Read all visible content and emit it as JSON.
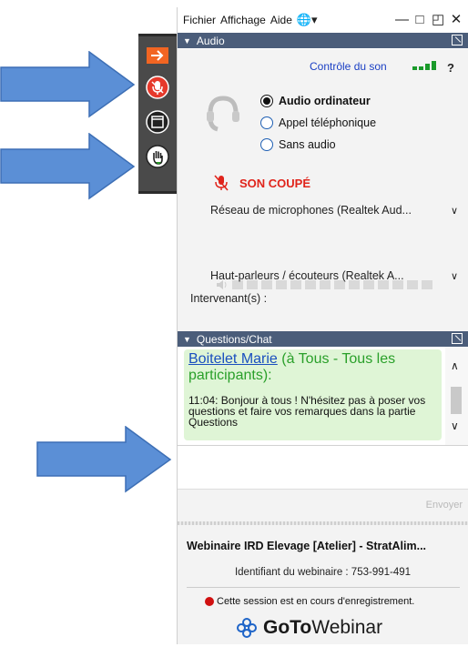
{
  "menubar": {
    "file": "Fichier",
    "view": "Affichage",
    "help": "Aide"
  },
  "audio": {
    "header": "Audio",
    "sound_control": "Contrôle du son",
    "help_mark": "?",
    "options": [
      {
        "label": "Audio ordinateur",
        "selected": true
      },
      {
        "label": "Appel téléphonique",
        "selected": false
      },
      {
        "label": "Sans audio",
        "selected": false
      }
    ],
    "mute_status": "SON COUPÉ",
    "microphone": "Réseau de microphones (Realtek Aud...",
    "speakers": "Haut-parleurs / écouteurs (Realtek A...",
    "speaker_level": 0,
    "speakers_label": "Intervenant(s) :"
  },
  "chat": {
    "header": "Questions/Chat",
    "messages": [
      {
        "author": "Boitelet Marie",
        "audience": "(à Tous - Tous les participants):",
        "text": "11:04: Bonjour à tous ! N'hésitez pas à poser vos questions et faire vos remarques dans la partie Questions"
      }
    ],
    "send_label": "Envoyer"
  },
  "footer": {
    "title": "Webinaire IRD Elevage [Atelier] - StratAlim...",
    "webinar_id": "Identifiant du webinaire : 753-991-491",
    "recording": "Cette session est en cours d'enregistrement.",
    "brand_bold": "GoTo",
    "brand_light": "Webinar"
  },
  "colors": {
    "arrow": "#5b8fd6",
    "header": "#4b5d7a",
    "mute": "#e0241b",
    "link": "#1a3fc4",
    "chat_bg": "#dff5d6"
  }
}
